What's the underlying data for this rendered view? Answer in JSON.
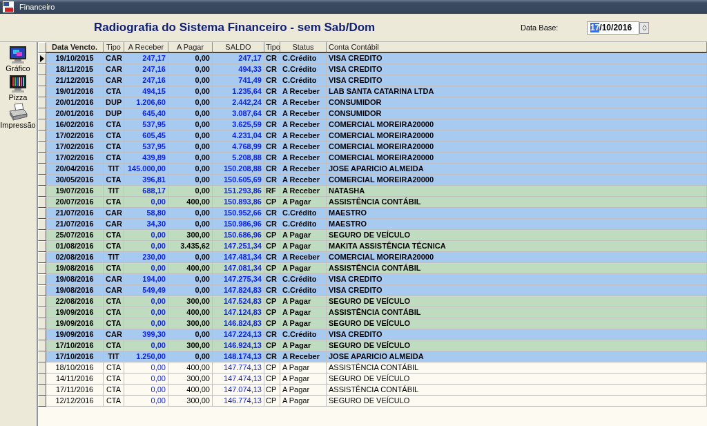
{
  "window": {
    "title": "Financeiro"
  },
  "header": {
    "title": "Radiografia do Sistema Financeiro - sem Sab/Dom",
    "date_label": "Data Base:",
    "date_value": "17/10/2016"
  },
  "toolbar": [
    {
      "kind": "chart",
      "label": "Gráfico"
    },
    {
      "kind": "pie",
      "label": "Pizza"
    },
    {
      "kind": "print",
      "label": "Impressão"
    }
  ],
  "table": {
    "columns": [
      "Data Vencto.",
      "Tipo",
      "A Receber",
      "A Pagar",
      "SALDO",
      "Tipo",
      "Status",
      "Conta Contábil"
    ],
    "rows": [
      {
        "date": "19/10/2015",
        "type": "CAR",
        "receive": "247,17",
        "pay": "0,00",
        "balance": "247,17",
        "group": "CR",
        "status": "C.Crédito",
        "account": "VISA CREDITO",
        "color": "#a6caf0",
        "bold": true,
        "selected": true
      },
      {
        "date": "18/11/2015",
        "type": "CAR",
        "receive": "247,16",
        "pay": "0,00",
        "balance": "494,33",
        "group": "CR",
        "status": "C.Crédito",
        "account": "VISA CREDITO",
        "color": "#a6caf0",
        "bold": true,
        "selected": false
      },
      {
        "date": "21/12/2015",
        "type": "CAR",
        "receive": "247,16",
        "pay": "0,00",
        "balance": "741,49",
        "group": "CR",
        "status": "C.Crédito",
        "account": "VISA CREDITO",
        "color": "#a6caf0",
        "bold": true,
        "selected": false
      },
      {
        "date": "19/01/2016",
        "type": "CTA",
        "receive": "494,15",
        "pay": "0,00",
        "balance": "1.235,64",
        "group": "CR",
        "status": "A Receber",
        "account": "LAB SANTA CATARINA LTDA",
        "color": "#a6caf0",
        "bold": true,
        "selected": false
      },
      {
        "date": "20/01/2016",
        "type": "DUP",
        "receive": "1.206,60",
        "pay": "0,00",
        "balance": "2.442,24",
        "group": "CR",
        "status": "A Receber",
        "account": "CONSUMIDOR",
        "color": "#a6caf0",
        "bold": true,
        "selected": false
      },
      {
        "date": "20/01/2016",
        "type": "DUP",
        "receive": "645,40",
        "pay": "0,00",
        "balance": "3.087,64",
        "group": "CR",
        "status": "A Receber",
        "account": "CONSUMIDOR",
        "color": "#a6caf0",
        "bold": true,
        "selected": false
      },
      {
        "date": "16/02/2016",
        "type": "CTA",
        "receive": "537,95",
        "pay": "0,00",
        "balance": "3.625,59",
        "group": "CR",
        "status": "A Receber",
        "account": "COMERCIAL MOREIRA20000",
        "color": "#a6caf0",
        "bold": true,
        "selected": false
      },
      {
        "date": "17/02/2016",
        "type": "CTA",
        "receive": "605,45",
        "pay": "0,00",
        "balance": "4.231,04",
        "group": "CR",
        "status": "A Receber",
        "account": "COMERCIAL MOREIRA20000",
        "color": "#a6caf0",
        "bold": true,
        "selected": false
      },
      {
        "date": "17/02/2016",
        "type": "CTA",
        "receive": "537,95",
        "pay": "0,00",
        "balance": "4.768,99",
        "group": "CR",
        "status": "A Receber",
        "account": "COMERCIAL MOREIRA20000",
        "color": "#a6caf0",
        "bold": true,
        "selected": false
      },
      {
        "date": "17/02/2016",
        "type": "CTA",
        "receive": "439,89",
        "pay": "0,00",
        "balance": "5.208,88",
        "group": "CR",
        "status": "A Receber",
        "account": "COMERCIAL MOREIRA20000",
        "color": "#a6caf0",
        "bold": true,
        "selected": false
      },
      {
        "date": "20/04/2016",
        "type": "TIT",
        "receive": "145.000,00",
        "pay": "0,00",
        "balance": "150.208,88",
        "group": "CR",
        "status": "A Receber",
        "account": "JOSE APARICIO ALMEIDA",
        "color": "#a6caf0",
        "bold": true,
        "selected": false
      },
      {
        "date": "30/05/2016",
        "type": "CTA",
        "receive": "396,81",
        "pay": "0,00",
        "balance": "150.605,69",
        "group": "CR",
        "status": "A Receber",
        "account": "COMERCIAL MOREIRA20000",
        "color": "#a6caf0",
        "bold": true,
        "selected": false
      },
      {
        "date": "19/07/2016",
        "type": "TIT",
        "receive": "688,17",
        "pay": "0,00",
        "balance": "151.293,86",
        "group": "RF",
        "status": "A Receber",
        "account": "NATASHA",
        "color": "#c0dcc0",
        "bold": true,
        "selected": false
      },
      {
        "date": "20/07/2016",
        "type": "CTA",
        "receive": "0,00",
        "pay": "400,00",
        "balance": "150.893,86",
        "group": "CP",
        "status": "A Pagar",
        "account": "ASSISTÊNCIA CONTÁBIL",
        "color": "#c0dcc0",
        "bold": true,
        "selected": false
      },
      {
        "date": "21/07/2016",
        "type": "CAR",
        "receive": "58,80",
        "pay": "0,00",
        "balance": "150.952,66",
        "group": "CR",
        "status": "C.Crédito",
        "account": "MAESTRO",
        "color": "#a6caf0",
        "bold": true,
        "selected": false
      },
      {
        "date": "21/07/2016",
        "type": "CAR",
        "receive": "34,30",
        "pay": "0,00",
        "balance": "150.986,96",
        "group": "CR",
        "status": "C.Crédito",
        "account": "MAESTRO",
        "color": "#a6caf0",
        "bold": true,
        "selected": false
      },
      {
        "date": "25/07/2016",
        "type": "CTA",
        "receive": "0,00",
        "pay": "300,00",
        "balance": "150.686,96",
        "group": "CP",
        "status": "A Pagar",
        "account": "SEGURO DE VEÍCULO",
        "color": "#c0dcc0",
        "bold": true,
        "selected": false
      },
      {
        "date": "01/08/2016",
        "type": "CTA",
        "receive": "0,00",
        "pay": "3.435,62",
        "balance": "147.251,34",
        "group": "CP",
        "status": "A Pagar",
        "account": "MAKITA ASSISTÊNCIA TÉCNICA",
        "color": "#c0dcc0",
        "bold": true,
        "selected": false
      },
      {
        "date": "02/08/2016",
        "type": "TIT",
        "receive": "230,00",
        "pay": "0,00",
        "balance": "147.481,34",
        "group": "CR",
        "status": "A Receber",
        "account": "COMERCIAL MOREIRA20000",
        "color": "#a6caf0",
        "bold": true,
        "selected": false
      },
      {
        "date": "19/08/2016",
        "type": "CTA",
        "receive": "0,00",
        "pay": "400,00",
        "balance": "147.081,34",
        "group": "CP",
        "status": "A Pagar",
        "account": "ASSISTÊNCIA CONTÁBIL",
        "color": "#c0dcc0",
        "bold": true,
        "selected": false
      },
      {
        "date": "19/08/2016",
        "type": "CAR",
        "receive": "194,00",
        "pay": "0,00",
        "balance": "147.275,34",
        "group": "CR",
        "status": "C.Crédito",
        "account": "VISA CREDITO",
        "color": "#a6caf0",
        "bold": true,
        "selected": false
      },
      {
        "date": "19/08/2016",
        "type": "CAR",
        "receive": "549,49",
        "pay": "0,00",
        "balance": "147.824,83",
        "group": "CR",
        "status": "C.Crédito",
        "account": "VISA CREDITO",
        "color": "#a6caf0",
        "bold": true,
        "selected": false
      },
      {
        "date": "22/08/2016",
        "type": "CTA",
        "receive": "0,00",
        "pay": "300,00",
        "balance": "147.524,83",
        "group": "CP",
        "status": "A Pagar",
        "account": "SEGURO DE VEÍCULO",
        "color": "#c0dcc0",
        "bold": true,
        "selected": false
      },
      {
        "date": "19/09/2016",
        "type": "CTA",
        "receive": "0,00",
        "pay": "400,00",
        "balance": "147.124,83",
        "group": "CP",
        "status": "A Pagar",
        "account": "ASSISTÊNCIA CONTÁBIL",
        "color": "#c0dcc0",
        "bold": true,
        "selected": false
      },
      {
        "date": "19/09/2016",
        "type": "CTA",
        "receive": "0,00",
        "pay": "300,00",
        "balance": "146.824,83",
        "group": "CP",
        "status": "A Pagar",
        "account": "SEGURO DE VEÍCULO",
        "color": "#c0dcc0",
        "bold": true,
        "selected": false
      },
      {
        "date": "19/09/2016",
        "type": "CAR",
        "receive": "399,30",
        "pay": "0,00",
        "balance": "147.224,13",
        "group": "CR",
        "status": "C.Crédito",
        "account": "VISA CREDITO",
        "color": "#a6caf0",
        "bold": true,
        "selected": false
      },
      {
        "date": "17/10/2016",
        "type": "CTA",
        "receive": "0,00",
        "pay": "300,00",
        "balance": "146.924,13",
        "group": "CP",
        "status": "A Pagar",
        "account": "SEGURO DE VEÍCULO",
        "color": "#c0dcc0",
        "bold": true,
        "selected": false
      },
      {
        "date": "17/10/2016",
        "type": "TIT",
        "receive": "1.250,00",
        "pay": "0,00",
        "balance": "148.174,13",
        "group": "CR",
        "status": "A Receber",
        "account": "JOSE APARICIO ALMEIDA",
        "color": "#a6caf0",
        "bold": true,
        "selected": false
      },
      {
        "date": "18/10/2016",
        "type": "CTA",
        "receive": "0,00",
        "pay": "400,00",
        "balance": "147.774,13",
        "group": "CP",
        "status": "A Pagar",
        "account": "ASSISTÊNCIA CONTÁBIL",
        "color": "#fdfaf2",
        "bold": false,
        "selected": false
      },
      {
        "date": "14/11/2016",
        "type": "CTA",
        "receive": "0,00",
        "pay": "300,00",
        "balance": "147.474,13",
        "group": "CP",
        "status": "A Pagar",
        "account": "SEGURO DE VEÍCULO",
        "color": "#fdfaf2",
        "bold": false,
        "selected": false
      },
      {
        "date": "17/11/2016",
        "type": "CTA",
        "receive": "0,00",
        "pay": "400,00",
        "balance": "147.074,13",
        "group": "CP",
        "status": "A Pagar",
        "account": "ASSISTÊNCIA CONTÁBIL",
        "color": "#fdfaf2",
        "bold": false,
        "selected": false
      },
      {
        "date": "12/12/2016",
        "type": "CTA",
        "receive": "0,00",
        "pay": "300,00",
        "balance": "146.774,13",
        "group": "CP",
        "status": "A Pagar",
        "account": "SEGURO DE VEÍCULO",
        "color": "#fdfaf2",
        "bold": false,
        "selected": false
      }
    ]
  }
}
